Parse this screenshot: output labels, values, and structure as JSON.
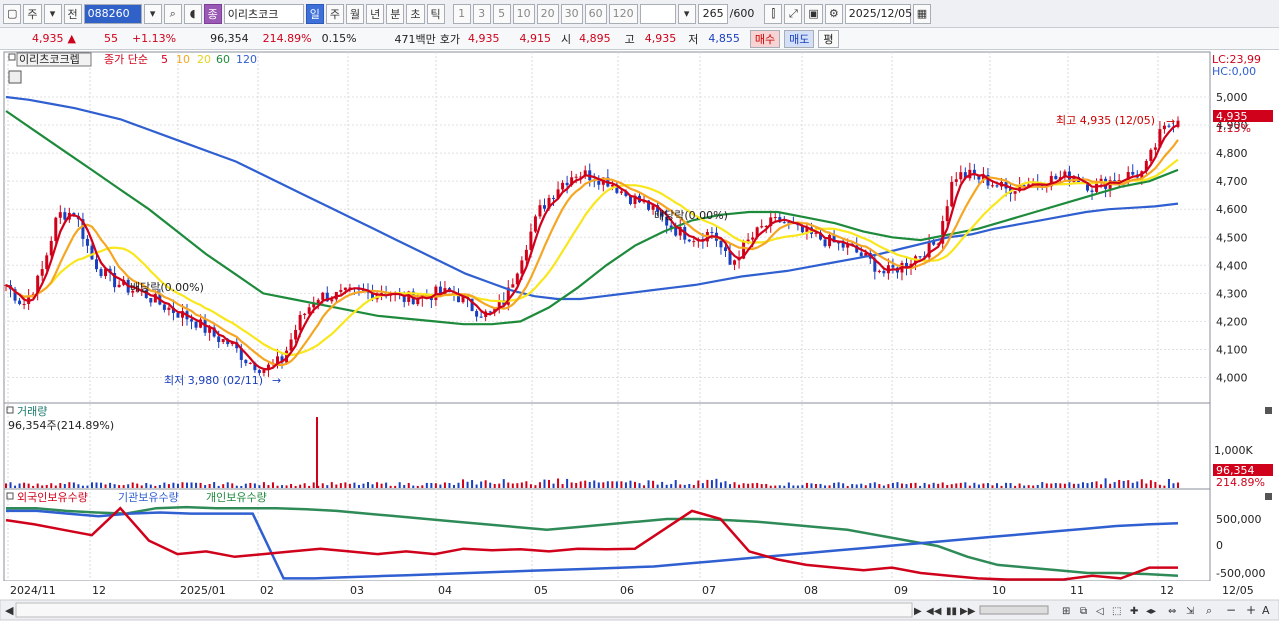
{
  "toolbar": {
    "period_main": "주",
    "jeon": "전",
    "code": "088260",
    "jong_icon": "종",
    "stock_name": "이리츠코크",
    "periods": [
      "일",
      "주",
      "월",
      "년",
      "분",
      "초",
      "틱"
    ],
    "numbers": [
      "1",
      "3",
      "5",
      "10",
      "20",
      "30",
      "60",
      "120"
    ],
    "count": "265",
    "total": "/600",
    "date": "2025/12/05"
  },
  "quote": {
    "price": "4,935",
    "arrow": "▲",
    "change": "55",
    "change_pct": "+1.13%",
    "volume": "96,354",
    "volume_pct": "214.89%",
    "turnover": "0.15%",
    "amount": "471백만",
    "hoga_label": "호가",
    "ask": "4,935",
    "bid": "4,915",
    "open_label": "시",
    "open": "4,895",
    "high_label": "고",
    "high": "4,935",
    "low_label": "저",
    "low": "4,855",
    "buy": "매수",
    "sell": "매도",
    "eval": "평"
  },
  "panels": {
    "price_title": "이리츠코크렙",
    "ma_label": "종가 단순",
    "ma_periods": [
      "5",
      "10",
      "20",
      "60",
      "120"
    ],
    "ma_colors": [
      "#d0021b",
      "#f5a623",
      "#f8e71c",
      "#1e8b3c",
      "#2f5fd0"
    ],
    "lc": "LC:23,99",
    "hc": "HC:0,00",
    "volume_title": "거래량",
    "volume_value": "96,354주(214.89%)",
    "holders": [
      "외국인보유수량",
      "기관보유수량",
      "개인보유수량"
    ]
  },
  "annotations": {
    "max": "최고 4,935 (12/05)",
    "min": "최저 3,980 (02/11)",
    "div1": "배당락(0.00%)",
    "div2": "배당락(0.00%)",
    "price_tag": "4,935",
    "pct_tag": "1.13%",
    "vol_tag": "96,354",
    "vol_pct_tag": "214.89%"
  },
  "chart_data": {
    "type": "line",
    "title": "이리츠코크렙",
    "price_axis": [
      5000,
      4900,
      4800,
      4700,
      4600,
      4500,
      4400,
      4300,
      4200,
      4100,
      4000
    ],
    "volume_axis": [
      "1,000K"
    ],
    "holding_axis": [
      "500,000",
      "0",
      "-500,000"
    ],
    "x_labels": [
      "2024/11",
      "12",
      "2025/01",
      "02",
      "03",
      "04",
      "05",
      "06",
      "07",
      "08",
      "09",
      "10",
      "11",
      "12",
      "12/05"
    ],
    "close_weekly": [
      4330,
      4260,
      4360,
      4580,
      4590,
      4420,
      4350,
      4320,
      4300,
      4260,
      4230,
      4200,
      4150,
      4120,
      4060,
      4030,
      4060,
      4200,
      4290,
      4290,
      4300,
      4300,
      4310,
      4280,
      4290,
      4300,
      4300,
      4250,
      4220,
      4280,
      4450,
      4600,
      4680,
      4730,
      4720,
      4700,
      4650,
      4620,
      4570,
      4520,
      4500,
      4520,
      4400,
      4480,
      4540,
      4560,
      4520,
      4500,
      4480,
      4460,
      4420,
      4370,
      4400,
      4440,
      4480,
      4720,
      4720,
      4700,
      4670,
      4690,
      4700,
      4710,
      4720,
      4680,
      4700,
      4720,
      4730,
      4870,
      4930
    ],
    "ma120": [
      5000,
      4990,
      4975,
      4960,
      4940,
      4920,
      4890,
      4860,
      4830,
      4800,
      4770,
      4730,
      4690,
      4650,
      4610,
      4570,
      4530,
      4490,
      4450,
      4410,
      4370,
      4340,
      4310,
      4290,
      4280,
      4280,
      4290,
      4300,
      4310,
      4320,
      4330,
      4345,
      4360,
      4370,
      4380,
      4395,
      4410,
      4425,
      4440,
      4460,
      4480,
      4500,
      4510,
      4530,
      4545,
      4560,
      4575,
      4590,
      4600,
      4605,
      4610,
      4620
    ],
    "ma60": [
      4950,
      4880,
      4810,
      4740,
      4670,
      4600,
      4520,
      4440,
      4370,
      4300,
      4280,
      4260,
      4240,
      4220,
      4210,
      4200,
      4190,
      4190,
      4200,
      4250,
      4320,
      4400,
      4470,
      4520,
      4560,
      4580,
      4590,
      4590,
      4570,
      4550,
      4520,
      4500,
      4490,
      4510,
      4530,
      4560,
      4590,
      4620,
      4650,
      4680,
      4700,
      4740
    ],
    "foreign": [
      480000,
      400000,
      300000,
      200000,
      700000,
      100000,
      -150000,
      -100000,
      -200000,
      -150000,
      -100000,
      -50000,
      -100000,
      -150000,
      -100000,
      -150000,
      -50000,
      -80000,
      -60000,
      -100000,
      -50000,
      -60000,
      -50000,
      300000,
      650000,
      500000,
      -100000,
      -250000,
      -350000,
      -400000,
      -450000,
      -400000,
      -500000,
      -550000,
      -600000,
      -620000,
      -620000,
      -620000,
      -550000,
      -600000,
      -400000,
      -400000
    ],
    "inst": [
      700000,
      700000,
      650000,
      620000,
      600000,
      700000,
      720000,
      700000,
      700000,
      700000,
      680000,
      650000,
      600000,
      550000,
      500000,
      450000,
      400000,
      350000,
      300000,
      350000,
      400000,
      450000,
      500000,
      500000,
      480000,
      450000,
      400000,
      350000,
      300000,
      200000,
      100000,
      0,
      -200000,
      -350000,
      -400000,
      -450000,
      -500000,
      -500000,
      -520000,
      -550000
    ],
    "indiv": [
      650000,
      650000,
      600000,
      550000,
      600000,
      620000,
      600000,
      600000,
      600000,
      -600000,
      -600000,
      -580000,
      -560000,
      -540000,
      -520000,
      -500000,
      -480000,
      -460000,
      -440000,
      -420000,
      -400000,
      -380000,
      -330000,
      -280000,
      -230000,
      -180000,
      -130000,
      -80000,
      -30000,
      20000,
      70000,
      120000,
      170000,
      220000,
      270000,
      320000,
      370000,
      400000,
      420000
    ]
  }
}
